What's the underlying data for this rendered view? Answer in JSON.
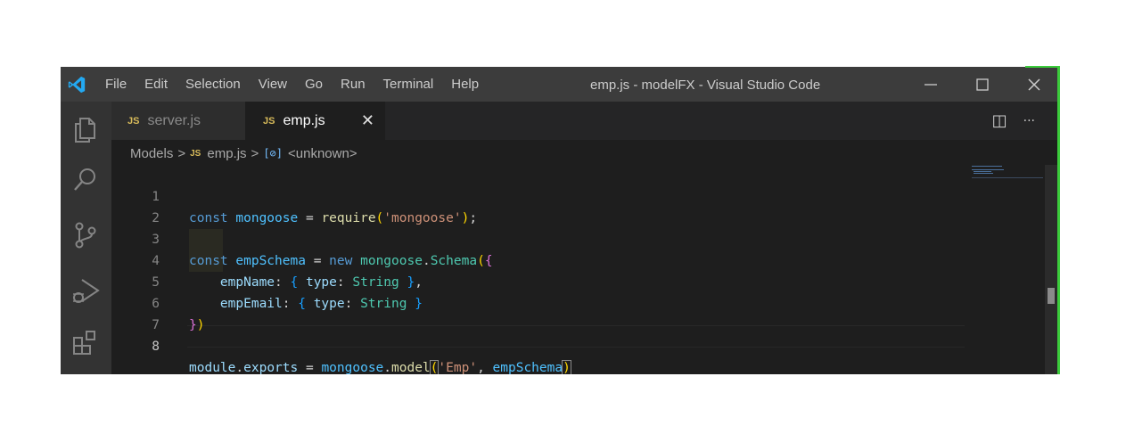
{
  "titlebar": {
    "menu": [
      "File",
      "Edit",
      "Selection",
      "View",
      "Go",
      "Run",
      "Terminal",
      "Help"
    ],
    "window_title": "emp.js - modelFX - Visual Studio Code"
  },
  "tabs": [
    {
      "badge": "JS",
      "label": "server.js",
      "active": false
    },
    {
      "badge": "JS",
      "label": "emp.js",
      "active": true,
      "close": "✕"
    }
  ],
  "tab_actions": {
    "split": "◫",
    "more": "···"
  },
  "breadcrumb": {
    "folder": "Models",
    "badge": "JS",
    "file": "emp.js",
    "symbol_icon": "[⊘]",
    "symbol": "<unknown>",
    "separator": ">"
  },
  "editor": {
    "active_line": 8,
    "line_numbers": [
      "1",
      "2",
      "3",
      "4",
      "5",
      "6",
      "7",
      "8"
    ]
  },
  "colors": {
    "titlebar": "#3c3c3c",
    "activity_bar": "#333333",
    "editor_bg": "#1e1e1e",
    "accent_logo": "#23a9f2",
    "window_edge": "#3ccc3c"
  },
  "icons": [
    "vscode-logo-icon",
    "explorer-icon",
    "search-icon",
    "source-control-icon",
    "run-debug-icon",
    "extensions-icon",
    "minimize-icon",
    "maximize-icon",
    "close-icon",
    "split-editor-icon",
    "more-actions-icon"
  ]
}
